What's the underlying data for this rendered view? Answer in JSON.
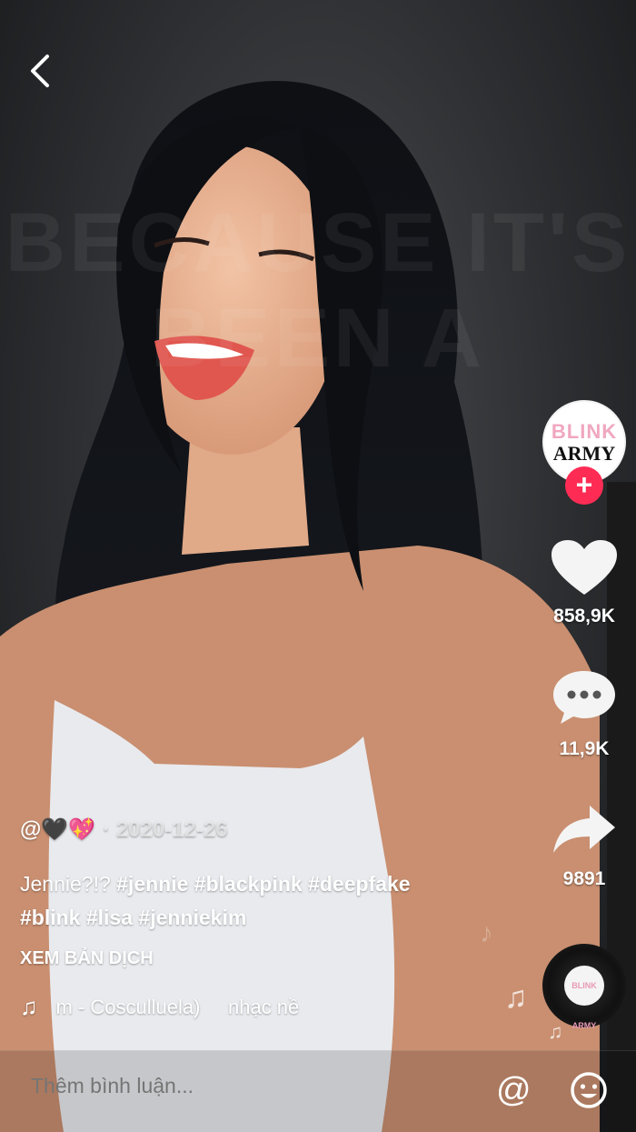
{
  "video": {
    "background_text": "BECAUSE IT'S BEEN A"
  },
  "nav": {
    "back_icon": "chevron-left-icon"
  },
  "profile": {
    "avatar_line1": "BLINK",
    "avatar_line2": "ARMY",
    "follow_symbol": "+"
  },
  "actions": {
    "likes": "858,9K",
    "comments": "11,9K",
    "shares": "9891"
  },
  "post": {
    "username": "@🖤💖",
    "date": "· 2020-12-26",
    "text": "Jennie?!?",
    "hashtags_line1": [
      "#jennie",
      "#blackpink",
      "#deepfake"
    ],
    "hashtags_line2": [
      "#blink",
      "#lisa",
      "#jenniekim"
    ],
    "translate_label": "XEM BẢN DỊCH",
    "music": "m - Cosculluela)     nhạc nề"
  },
  "disc": {
    "label": "BLINK ARMY"
  },
  "comment": {
    "placeholder": "Thêm bình luận..."
  },
  "colors": {
    "follow": "#fe2c55",
    "avatar_pink": "#f0a7c0"
  }
}
